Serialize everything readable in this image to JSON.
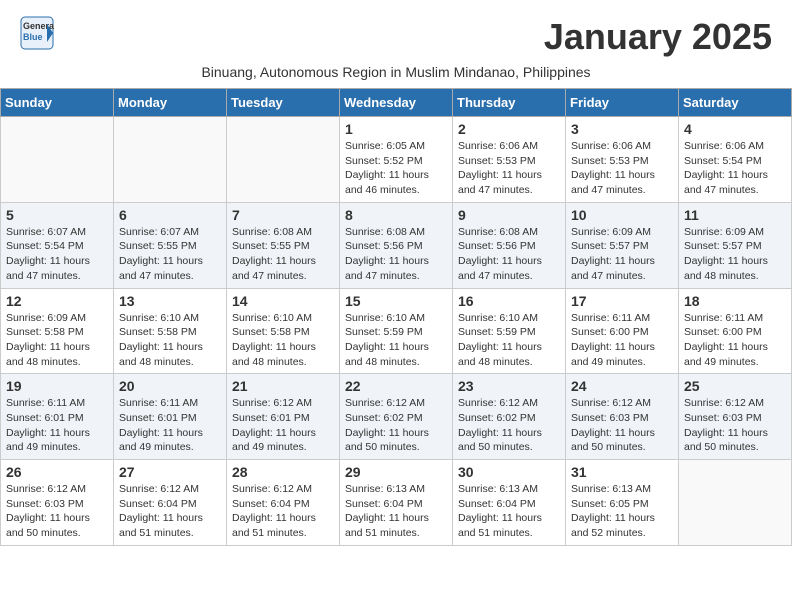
{
  "logo": {
    "general": "General",
    "blue": "Blue"
  },
  "header": {
    "month_title": "January 2025",
    "subtitle": "Binuang, Autonomous Region in Muslim Mindanao, Philippines"
  },
  "days_of_week": [
    "Sunday",
    "Monday",
    "Tuesday",
    "Wednesday",
    "Thursday",
    "Friday",
    "Saturday"
  ],
  "weeks": [
    {
      "shaded": false,
      "days": [
        {
          "num": "",
          "info": ""
        },
        {
          "num": "",
          "info": ""
        },
        {
          "num": "",
          "info": ""
        },
        {
          "num": "1",
          "info": "Sunrise: 6:05 AM\nSunset: 5:52 PM\nDaylight: 11 hours\nand 46 minutes."
        },
        {
          "num": "2",
          "info": "Sunrise: 6:06 AM\nSunset: 5:53 PM\nDaylight: 11 hours\nand 47 minutes."
        },
        {
          "num": "3",
          "info": "Sunrise: 6:06 AM\nSunset: 5:53 PM\nDaylight: 11 hours\nand 47 minutes."
        },
        {
          "num": "4",
          "info": "Sunrise: 6:06 AM\nSunset: 5:54 PM\nDaylight: 11 hours\nand 47 minutes."
        }
      ]
    },
    {
      "shaded": true,
      "days": [
        {
          "num": "5",
          "info": "Sunrise: 6:07 AM\nSunset: 5:54 PM\nDaylight: 11 hours\nand 47 minutes."
        },
        {
          "num": "6",
          "info": "Sunrise: 6:07 AM\nSunset: 5:55 PM\nDaylight: 11 hours\nand 47 minutes."
        },
        {
          "num": "7",
          "info": "Sunrise: 6:08 AM\nSunset: 5:55 PM\nDaylight: 11 hours\nand 47 minutes."
        },
        {
          "num": "8",
          "info": "Sunrise: 6:08 AM\nSunset: 5:56 PM\nDaylight: 11 hours\nand 47 minutes."
        },
        {
          "num": "9",
          "info": "Sunrise: 6:08 AM\nSunset: 5:56 PM\nDaylight: 11 hours\nand 47 minutes."
        },
        {
          "num": "10",
          "info": "Sunrise: 6:09 AM\nSunset: 5:57 PM\nDaylight: 11 hours\nand 47 minutes."
        },
        {
          "num": "11",
          "info": "Sunrise: 6:09 AM\nSunset: 5:57 PM\nDaylight: 11 hours\nand 48 minutes."
        }
      ]
    },
    {
      "shaded": false,
      "days": [
        {
          "num": "12",
          "info": "Sunrise: 6:09 AM\nSunset: 5:58 PM\nDaylight: 11 hours\nand 48 minutes."
        },
        {
          "num": "13",
          "info": "Sunrise: 6:10 AM\nSunset: 5:58 PM\nDaylight: 11 hours\nand 48 minutes."
        },
        {
          "num": "14",
          "info": "Sunrise: 6:10 AM\nSunset: 5:58 PM\nDaylight: 11 hours\nand 48 minutes."
        },
        {
          "num": "15",
          "info": "Sunrise: 6:10 AM\nSunset: 5:59 PM\nDaylight: 11 hours\nand 48 minutes."
        },
        {
          "num": "16",
          "info": "Sunrise: 6:10 AM\nSunset: 5:59 PM\nDaylight: 11 hours\nand 48 minutes."
        },
        {
          "num": "17",
          "info": "Sunrise: 6:11 AM\nSunset: 6:00 PM\nDaylight: 11 hours\nand 49 minutes."
        },
        {
          "num": "18",
          "info": "Sunrise: 6:11 AM\nSunset: 6:00 PM\nDaylight: 11 hours\nand 49 minutes."
        }
      ]
    },
    {
      "shaded": true,
      "days": [
        {
          "num": "19",
          "info": "Sunrise: 6:11 AM\nSunset: 6:01 PM\nDaylight: 11 hours\nand 49 minutes."
        },
        {
          "num": "20",
          "info": "Sunrise: 6:11 AM\nSunset: 6:01 PM\nDaylight: 11 hours\nand 49 minutes."
        },
        {
          "num": "21",
          "info": "Sunrise: 6:12 AM\nSunset: 6:01 PM\nDaylight: 11 hours\nand 49 minutes."
        },
        {
          "num": "22",
          "info": "Sunrise: 6:12 AM\nSunset: 6:02 PM\nDaylight: 11 hours\nand 50 minutes."
        },
        {
          "num": "23",
          "info": "Sunrise: 6:12 AM\nSunset: 6:02 PM\nDaylight: 11 hours\nand 50 minutes."
        },
        {
          "num": "24",
          "info": "Sunrise: 6:12 AM\nSunset: 6:03 PM\nDaylight: 11 hours\nand 50 minutes."
        },
        {
          "num": "25",
          "info": "Sunrise: 6:12 AM\nSunset: 6:03 PM\nDaylight: 11 hours\nand 50 minutes."
        }
      ]
    },
    {
      "shaded": false,
      "days": [
        {
          "num": "26",
          "info": "Sunrise: 6:12 AM\nSunset: 6:03 PM\nDaylight: 11 hours\nand 50 minutes."
        },
        {
          "num": "27",
          "info": "Sunrise: 6:12 AM\nSunset: 6:04 PM\nDaylight: 11 hours\nand 51 minutes."
        },
        {
          "num": "28",
          "info": "Sunrise: 6:12 AM\nSunset: 6:04 PM\nDaylight: 11 hours\nand 51 minutes."
        },
        {
          "num": "29",
          "info": "Sunrise: 6:13 AM\nSunset: 6:04 PM\nDaylight: 11 hours\nand 51 minutes."
        },
        {
          "num": "30",
          "info": "Sunrise: 6:13 AM\nSunset: 6:04 PM\nDaylight: 11 hours\nand 51 minutes."
        },
        {
          "num": "31",
          "info": "Sunrise: 6:13 AM\nSunset: 6:05 PM\nDaylight: 11 hours\nand 52 minutes."
        },
        {
          "num": "",
          "info": ""
        }
      ]
    }
  ]
}
